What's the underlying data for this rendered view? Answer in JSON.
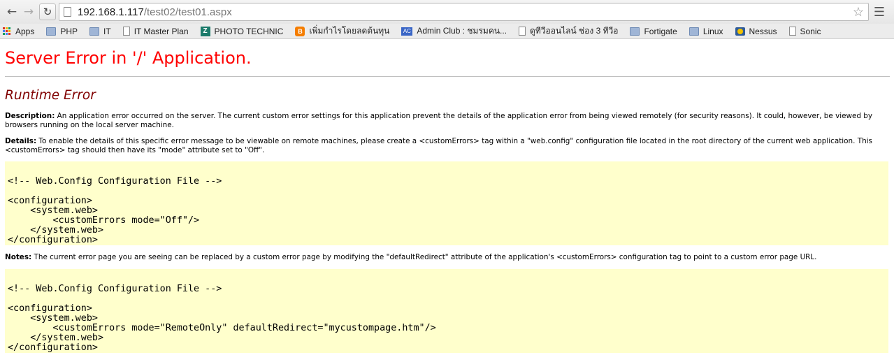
{
  "browser": {
    "url_host": "192.168.1.117",
    "url_path": "/test02/test01.aspx",
    "bookmarks": [
      {
        "label": "Apps",
        "icon": "apps-grid-icon"
      },
      {
        "label": "PHP",
        "icon": "folder-icon"
      },
      {
        "label": "IT",
        "icon": "folder-icon"
      },
      {
        "label": "IT Master Plan",
        "icon": "page-icon"
      },
      {
        "label": "PHOTO TECHNIC",
        "icon": "z-logo-icon"
      },
      {
        "label": "เพิ่มกำไรโดยลดต้นทุน",
        "icon": "blogger-icon"
      },
      {
        "label": "Admin Club : ชมรมคน...",
        "icon": "admin-club-icon"
      },
      {
        "label": "ดูทีวีออนไลน์ ช่อง 3 ทีวีอ",
        "icon": "page-icon"
      },
      {
        "label": "Fortigate",
        "icon": "folder-icon"
      },
      {
        "label": "Linux",
        "icon": "folder-icon"
      },
      {
        "label": "Nessus",
        "icon": "nessus-icon"
      },
      {
        "label": "Sonic",
        "icon": "page-icon"
      }
    ]
  },
  "page": {
    "title": "Server Error in '/' Application.",
    "subtitle": "Runtime Error",
    "description_label": "Description:",
    "description_text": " An application error occurred on the server. The current custom error settings for this application prevent the details of the application error from being viewed remotely (for security reasons). It could, however, be viewed by browsers running on the local server machine.",
    "details_label": "Details:",
    "details_text": " To enable the details of this specific error message to be viewable on remote machines, please create a <customErrors> tag within a \"web.config\" configuration file located in the root directory of the current web application. This <customErrors> tag should then have its \"mode\" attribute set to \"Off\".",
    "code1": {
      "comment": "<!-- Web.Config Configuration File -->",
      "lines": [
        "<configuration>",
        "    <system.web>",
        "        <customErrors mode=\"Off\"/>",
        "    </system.web>",
        "</configuration>"
      ]
    },
    "notes_label": "Notes:",
    "notes_text": " The current error page you are seeing can be replaced by a custom error page by modifying the \"defaultRedirect\" attribute of the application's <customErrors> configuration tag to point to a custom error page URL.",
    "code2": {
      "comment": "<!-- Web.Config Configuration File -->",
      "lines": [
        "<configuration>",
        "    <system.web>",
        "        <customErrors mode=\"RemoteOnly\" defaultRedirect=\"mycustompage.htm\"/>",
        "    </system.web>",
        "</configuration>"
      ]
    }
  },
  "colors": {
    "title": "#ff0000",
    "subtitle": "#800000",
    "code_background": "#ffffcc"
  }
}
